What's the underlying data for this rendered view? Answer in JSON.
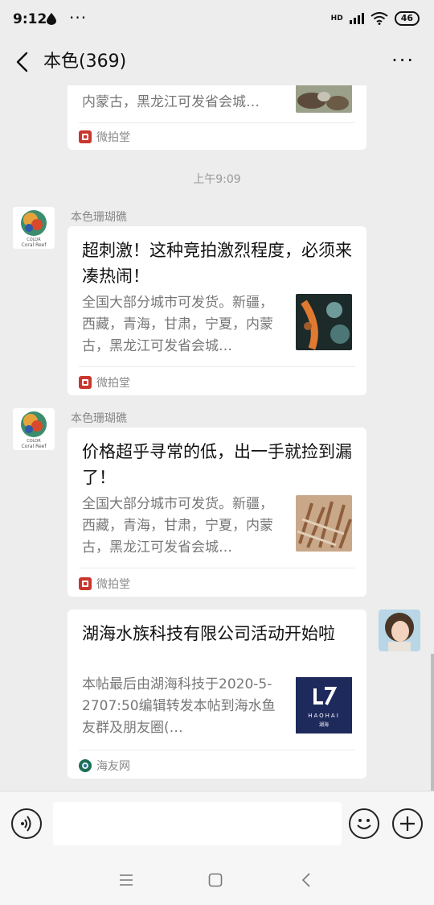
{
  "status_bar": {
    "time": "9:12",
    "dots": "···",
    "network": "HD",
    "battery": "46"
  },
  "header": {
    "title": "本色(369)",
    "more": "···"
  },
  "messages": {
    "partial": {
      "desc_last_line": "内蒙古，黑龙江可发省会城…",
      "source": "微拍堂"
    },
    "timestamp": "上午9:09",
    "m1": {
      "sender": "本色珊瑚礁",
      "title": "超刺激！这种竞拍激烈程度，必须来凑热闹！",
      "desc": "全国大部分城市可发货。新疆，西藏，青海，甘肃，宁夏，内蒙古，黑龙江可发省会城…",
      "source": "微拍堂"
    },
    "m2": {
      "sender": "本色珊瑚礁",
      "title": "价格超乎寻常的低，出一手就捡到漏了！",
      "desc": "全国大部分城市可发货。新疆，西藏，青海，甘肃，宁夏，内蒙古，黑龙江可发省会城…",
      "source": "微拍堂"
    },
    "m3": {
      "title": "湖海水族科技有限公司活动开始啦",
      "desc": "本帖最后由湖海科技于2020-5-2707:50编辑转发本帖到海水鱼友群及朋友圈(…",
      "source": "海友网",
      "thumb_logo": "HAOHAI",
      "thumb_sub": "湖海"
    }
  },
  "avatar_text": {
    "line1": "COLOR",
    "line2": "Coral Reef"
  },
  "colors": {
    "wechat_bg": "#ededed",
    "card": "#ffffff",
    "brand_red": "#c8372d",
    "navy": "#1f2a5c"
  }
}
